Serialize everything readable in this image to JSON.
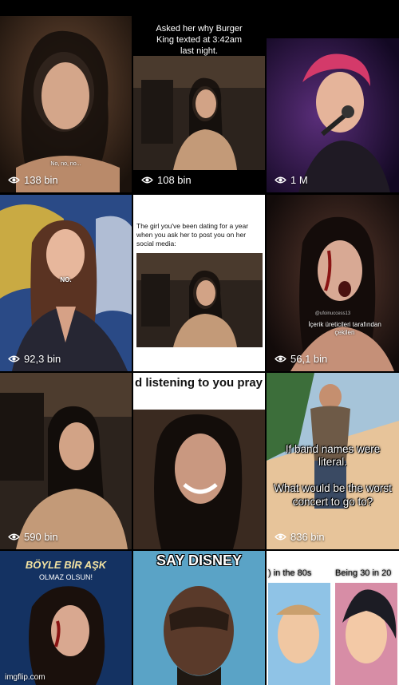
{
  "tiles": [
    {
      "id": "t1",
      "views": "138 bin",
      "subtitle": "No, no, no..."
    },
    {
      "id": "t2",
      "views": "108 bin",
      "caption": "Asked her why Burger King texted at 3:42am last night."
    },
    {
      "id": "t3",
      "views": "1 M"
    },
    {
      "id": "t4",
      "views": "",
      "label": "NO."
    },
    {
      "id": "t5",
      "views": "",
      "caption": "The girl you've been dating for a year when you ask her to post you on her social media:"
    },
    {
      "id": "t6",
      "views": "56,1 bin",
      "handle": "@ufoinuccess13",
      "credit": "İçerik üreticileri tarafından çekilen"
    },
    {
      "id": "t7",
      "views": "590 bin"
    },
    {
      "id": "t8",
      "views": "",
      "banner": "d listening to you pray for y rn ligament to heal overnig"
    },
    {
      "id": "t9",
      "views": "836 bin",
      "overlay": "If band names were literal.\n\nWhat would be the worst concert to go to?"
    },
    {
      "id": "t10",
      "title": "BÖYLE BİR AŞK",
      "subtitle": "OLMAZ OLSUN!",
      "watermark": "imgflip.com"
    },
    {
      "id": "t11",
      "banner": "SAY DISNEY"
    },
    {
      "id": "t12",
      "left_label": ") in the 80s",
      "right_label": "Being 30 in 20"
    }
  ],
  "tile4_views": "92,3 bin",
  "colors": {
    "bg": "#000000",
    "text": "#ffffff"
  }
}
